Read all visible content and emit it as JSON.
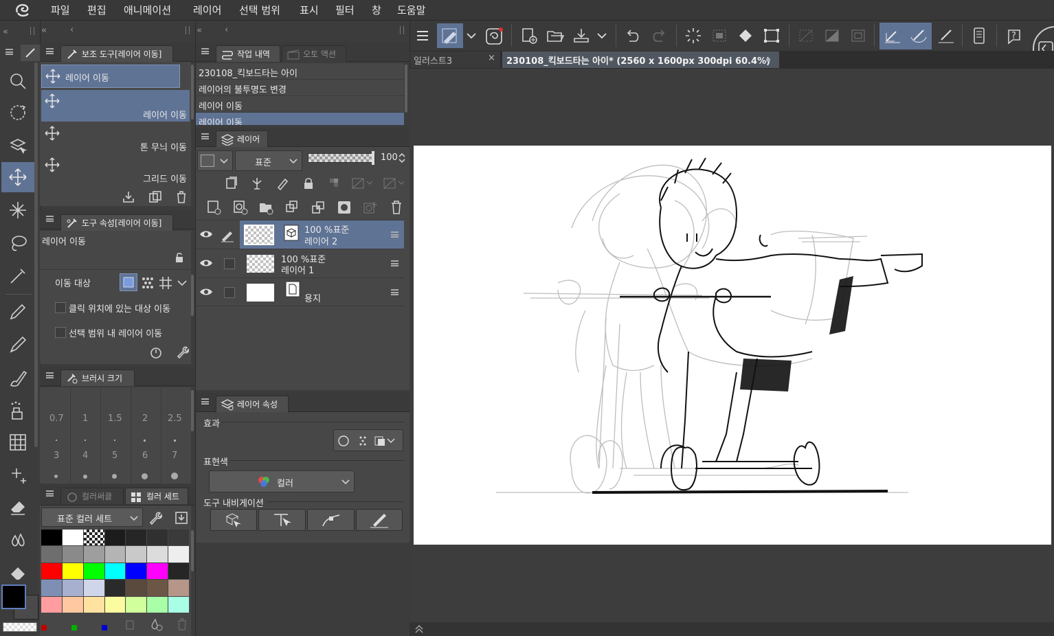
{
  "menu": [
    "파일",
    "편집",
    "애니메이션",
    "레이어",
    "선택 범위",
    "표시",
    "필터",
    "창",
    "도움말"
  ],
  "sub_tool": {
    "tab_label": "보조 도구[레이어 이동]",
    "items": [
      {
        "label": "레이어 이동",
        "selected": true
      },
      {
        "label": "레이어 이동",
        "selected": true
      },
      {
        "label": "톤 무늬 이동",
        "selected": false
      },
      {
        "label": "그리드 이동",
        "selected": false
      }
    ]
  },
  "tool_property": {
    "tab_label": "도구 속성[레이어 이동]",
    "tool_name": "레이어 이동",
    "move_target_label": "이동 대상",
    "option_click_label": "클릭 위치에 있는 대상 이동",
    "option_selection_label": "선택 범위 내 레이어 이동"
  },
  "brush_size": {
    "tab_label": "브러시 크기",
    "row1": [
      "0.7",
      "1",
      "1.5",
      "2",
      "2.5"
    ],
    "row2": [
      "3",
      "4",
      "5",
      "6",
      "7"
    ]
  },
  "color_panel": {
    "tab_inactive": "컬러써클",
    "tab_active": "컬러 세트",
    "set_name": "표준 컬러 세트",
    "swatches": [
      [
        "#000000",
        "#ffffff",
        "transparent",
        "#1c1c1c",
        "#262626",
        "#303030",
        "#3a3a3a"
      ],
      [
        "#6e6e6e",
        "#8a8a8a",
        "#9e9e9e",
        "#b4b4b4",
        "#c9c9c9",
        "#dcdcdc",
        "#eeeeee"
      ],
      [
        "#ff0000",
        "#ffff00",
        "#00ff00",
        "#00ffff",
        "#0000ff",
        "#ff00ff",
        "#262626"
      ],
      [
        "#7f8fb4",
        "#a8b0cf",
        "#cfd6ea",
        "#2a2a2a",
        "#5a4a3e",
        "#6c5646",
        "#b59688"
      ],
      [
        "#ff9da0",
        "#ffc8a0",
        "#ffe2a0",
        "#fbfba0",
        "#d0ff9c",
        "#a8ffa8",
        "#a8ffe6"
      ]
    ],
    "main_color": "#000000"
  },
  "history": {
    "tab_label": "작업 내역",
    "tab_inactive": "오토 액션",
    "items": [
      "230108_킥보드타는 아이",
      "레이어의 불투명도 변경",
      "레이어 이동",
      "레이어 이동"
    ]
  },
  "layer_panel": {
    "tab_label": "레이어",
    "blend_mode": "표준",
    "opacity": "100",
    "layers": [
      {
        "percent": "100 %",
        "mode": "표준",
        "name": "레이어 2",
        "selected": true
      },
      {
        "percent": "100 %",
        "mode": "표준",
        "name": "레이어 1",
        "selected": false
      },
      {
        "name": "용지",
        "selected": false
      }
    ]
  },
  "layer_property": {
    "tab_label": "레이어 속성",
    "effect_label": "효과",
    "color_label": "표현색",
    "color_value": "컬러",
    "navigation_label": "도구 내비게이션"
  },
  "documents": {
    "tabs": [
      {
        "label": "일러스트3",
        "active": false
      },
      {
        "label": "230108_킥보드타는 아이* (2560 x 1600px 300dpi 60.4%)",
        "active": true
      }
    ]
  },
  "colors": {
    "accent": "#5f7395",
    "panel": "#474747",
    "canvas": "#ffffff"
  }
}
